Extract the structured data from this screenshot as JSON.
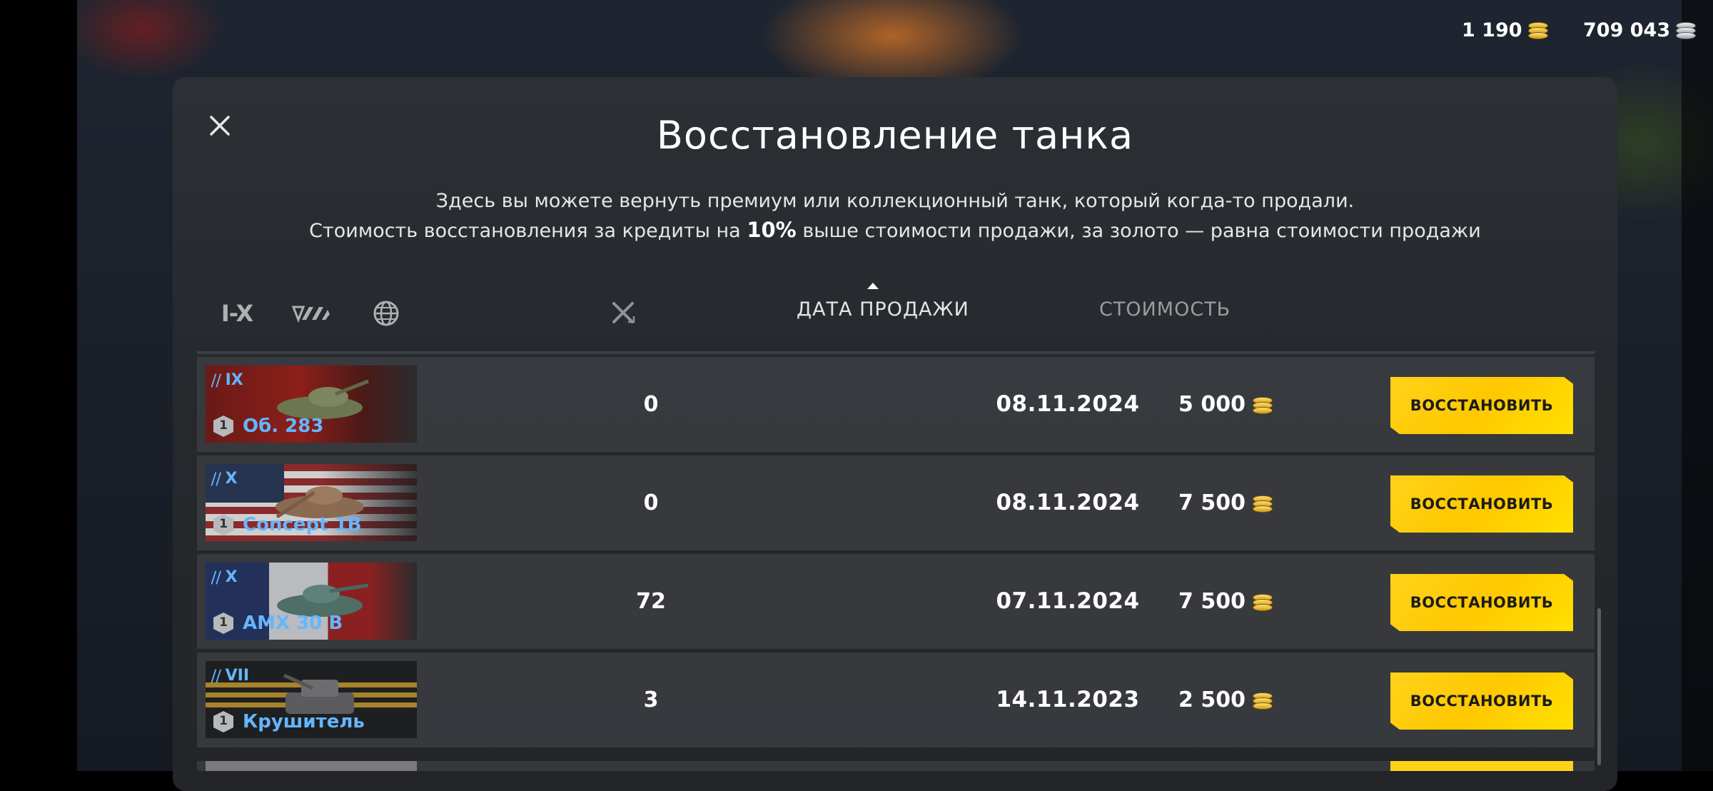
{
  "header": {
    "gold": "1 190",
    "credits": "709 043"
  },
  "dialog": {
    "title": "Восстановление танка",
    "subtitle_line1": "Здесь вы можете вернуть премиум или коллекционный танк, который когда-то продали.",
    "subtitle_line2_pre": "Стоимость восстановления за кредиты на ",
    "subtitle_line2_bold": "10%",
    "subtitle_line2_post": " выше стоимости продажи, за золото — равна стоимости продажи",
    "filters": {
      "tier_label": "I-X"
    },
    "columns": {
      "date": "ДАТА ПРОДАЖИ",
      "cost": "СТОИМОСТЬ"
    },
    "restore_label": "ВОССТАНОВИТЬ",
    "rows": [
      {
        "tier": "IX",
        "name": "Об. 283",
        "mastery": "1",
        "battles": "0",
        "date": "08.11.2024",
        "cost": "5 000",
        "flag": "ussr"
      },
      {
        "tier": "X",
        "name": "Concept 1B",
        "mastery": "1",
        "battles": "0",
        "date": "08.11.2024",
        "cost": "7 500",
        "flag": "usa"
      },
      {
        "tier": "X",
        "name": "AMX 30 B",
        "mastery": "1",
        "battles": "72",
        "date": "07.11.2024",
        "cost": "7 500",
        "flag": "france"
      },
      {
        "tier": "VII",
        "name": "Крушитель",
        "mastery": "1",
        "battles": "3",
        "date": "14.11.2023",
        "cost": "2 500",
        "flag": "collector"
      }
    ]
  },
  "icons": {
    "close": "close-icon",
    "tier_filter": "tier-filter-icon",
    "type_filter": "vehicle-type-filter-icon",
    "nation_filter": "nation-globe-icon",
    "battles_column": "crossed-swords-icon",
    "gold_coin": "gold-coin-icon",
    "silver_coin": "credits-coin-icon"
  },
  "colors": {
    "accent_yellow": "#ffd21a",
    "tank_name_blue": "#64b6ff",
    "panel_bg": "#2a2d31"
  }
}
